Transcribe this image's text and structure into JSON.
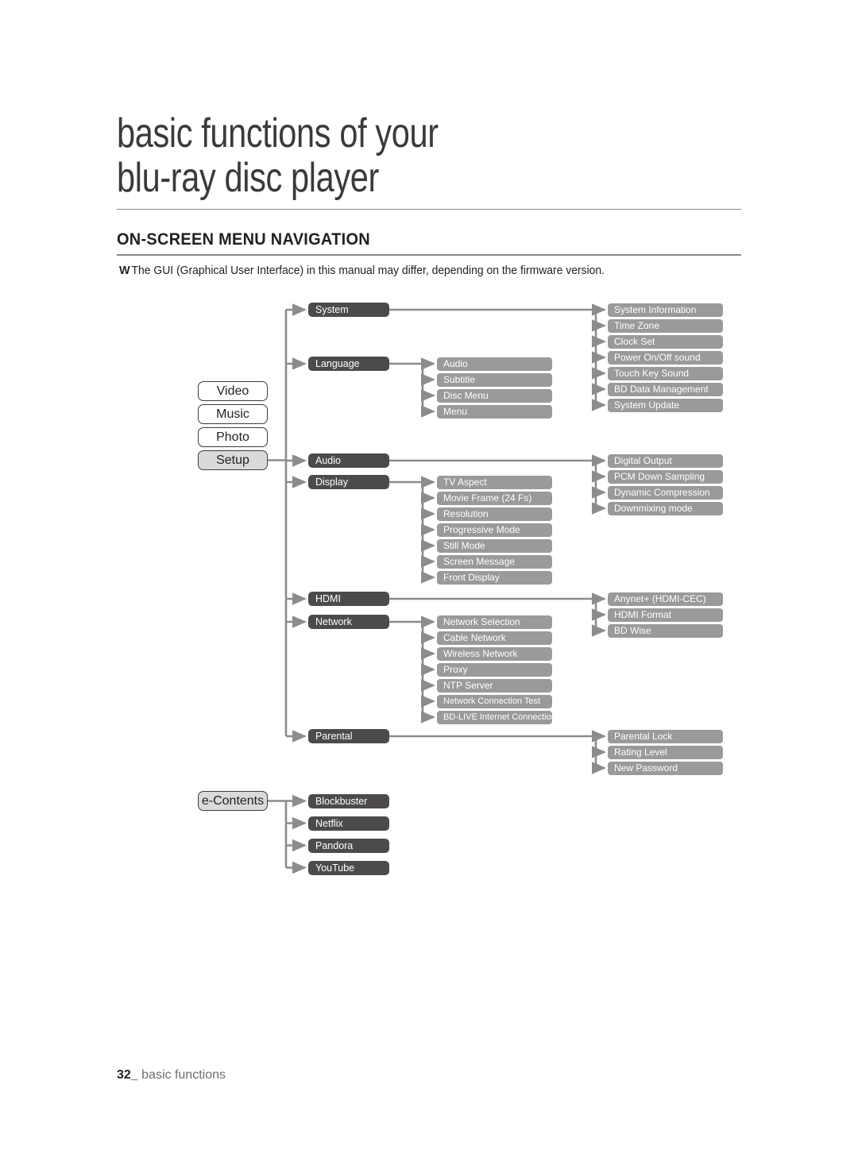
{
  "header": {
    "chapter_line1": "basic functions of your",
    "chapter_line2": "blu-ray disc player",
    "section_title": "ON-SCREEN MENU NAVIGATION",
    "note_mark": "W",
    "note_text": "The GUI (Graphical User Interface) in this manual may differ, depending on the firmware version."
  },
  "footer": {
    "page_number": "32_",
    "page_label": "basic functions"
  },
  "colors": {
    "level1_fill": "#4d4a4a",
    "level2_fill": "#9a9a9a",
    "root_selected_fill": "#dadada",
    "connector": "#8c8c8c",
    "rule": "#8a8a8a"
  },
  "diagram": {
    "title": "On-Screen Menu Navigation tree",
    "root_menu": [
      {
        "label": "Video",
        "selected": false
      },
      {
        "label": "Music",
        "selected": false
      },
      {
        "label": "Photo",
        "selected": false
      },
      {
        "label": "Setup",
        "selected": true
      }
    ],
    "setup_branches": [
      {
        "label": "System",
        "children": [],
        "grandchildren": [
          "System Information",
          "Time Zone",
          "Clock Set",
          "Power On/Off sound",
          "Touch Key Sound",
          "BD Data Management",
          "System Update"
        ]
      },
      {
        "label": "Language",
        "children": [
          "Audio",
          "Subtitle",
          "Disc Menu",
          "Menu"
        ],
        "grandchildren": []
      },
      {
        "label": "Audio",
        "children": [],
        "grandchildren": [
          "Digital Output",
          "PCM Down Sampling",
          "Dynamic Compression",
          "Downmixing mode"
        ]
      },
      {
        "label": "Display",
        "children": [
          "TV Aspect",
          "Movie Frame (24 Fs)",
          "Resolution",
          "Progressive Mode",
          "Still Mode",
          "Screen Message",
          "Front Display"
        ],
        "grandchildren": []
      },
      {
        "label": "HDMI",
        "children": [],
        "grandchildren": [
          "Anynet+ (HDMI-CEC)",
          "HDMI Format",
          "BD Wise"
        ]
      },
      {
        "label": "Network",
        "children": [
          "Network Selection",
          "Cable Network",
          "Wireless Network",
          "Proxy",
          "NTP Server",
          "Network Connection Test",
          "BD-LIVE Internet Connection"
        ],
        "grandchildren": []
      },
      {
        "label": "Parental",
        "children": [],
        "grandchildren": [
          "Parental Lock",
          "Rating Level",
          "New Password"
        ]
      }
    ],
    "econtents": {
      "label": "e-Contents",
      "items": [
        "Blockbuster",
        "Netflix",
        "Pandora",
        "YouTube"
      ]
    }
  }
}
